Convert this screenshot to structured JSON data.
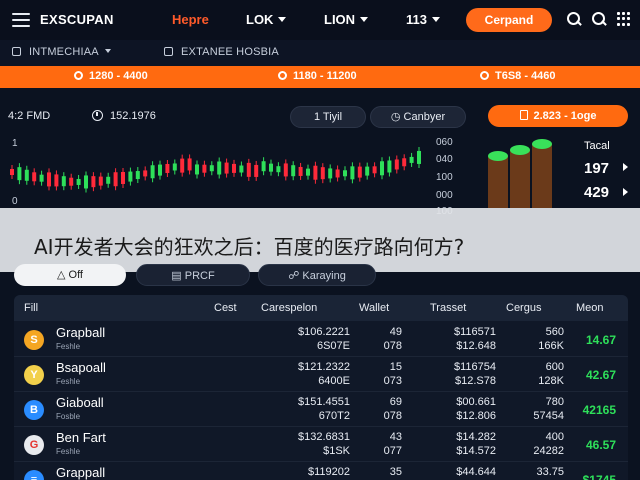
{
  "topnav": {
    "brand": "EXSCUPAN",
    "items": [
      {
        "label": "Hepre",
        "active": true,
        "caret": false
      },
      {
        "label": "LOK",
        "active": false,
        "caret": true
      },
      {
        "label": "LION",
        "active": false,
        "caret": true
      },
      {
        "label": "113",
        "active": false,
        "caret": true
      }
    ],
    "cta_label": "Cerpand",
    "icons": [
      "menu-icon",
      "search-icon",
      "search-icon",
      "grid-icon"
    ]
  },
  "subnav": {
    "left_label": "INTMECHIAA",
    "right_label": "EXTANEE HOSBIA"
  },
  "ticker": {
    "items": [
      "1280 - 4400",
      "1180 - 11200",
      "T6S8 - 4460"
    ],
    "color": "#ff6a10"
  },
  "chart_header": {
    "price_label": "4:2 FMD",
    "time_label": "152.1976",
    "pill_1": "1 Tiyil",
    "pill_2": "Canbyer",
    "pill_orange": "2.823 - 1oge"
  },
  "chart_data": {
    "type": "candlestick",
    "yaxis_ticks": [
      "060",
      "040",
      "100",
      "000",
      "100"
    ],
    "left_ticks": [
      "1",
      "0"
    ],
    "candles_up_color": "#2ee05a",
    "candles_down_color": "#ff2a3a"
  },
  "side_panel": {
    "label": "Tacal",
    "value_1": "197",
    "value_2": "429"
  },
  "banner": {
    "title": "AI开发者大会的狂欢之后：百度的医疗路向何方?"
  },
  "filters": [
    {
      "label": "Off",
      "style": "light"
    },
    {
      "label": "PRCF",
      "style": "dark"
    },
    {
      "label": "Karaying",
      "style": "dark"
    }
  ],
  "table": {
    "headers": [
      "Fill",
      "Cest",
      "Carespelon",
      "Wallet",
      "Trasset",
      "Cergus",
      "Meon"
    ],
    "rows": [
      {
        "name": "Grapball",
        "sub": "Feshle",
        "coin": "S",
        "coin_color": "#f5a623",
        "carespelon": [
          "$106.2221",
          "6S07E"
        ],
        "wallet": [
          "49",
          "078"
        ],
        "trasset": [
          "$116571",
          "$12.648"
        ],
        "cergus": [
          "560",
          "166K"
        ],
        "meon": "14.67"
      },
      {
        "name": "Bsapoall",
        "sub": "Feshle",
        "coin": "Y",
        "coin_color": "#f2d04b",
        "carespelon": [
          "$121.2322",
          "6400E"
        ],
        "wallet": [
          "15",
          "073"
        ],
        "trasset": [
          "$116754",
          "$12.S78"
        ],
        "cergus": [
          "600",
          "128K"
        ],
        "meon": "42.67"
      },
      {
        "name": "Giaboall",
        "sub": "Fosble",
        "coin": "B",
        "coin_color": "#2a8cff",
        "carespelon": [
          "$151.4551",
          "670T2"
        ],
        "wallet": [
          "69",
          "078"
        ],
        "trasset": [
          "$00.661",
          "$12.806"
        ],
        "cergus": [
          "780",
          "57454"
        ],
        "meon": "42165"
      },
      {
        "name": "Ben Fart",
        "sub": "Feshle",
        "coin": "G",
        "coin_color": "#e8eaee",
        "carespelon": [
          "$132.6831",
          "$1SK"
        ],
        "wallet": [
          "43",
          "077"
        ],
        "trasset": [
          "$14.282",
          "$14.572"
        ],
        "cergus": [
          "400",
          "24282"
        ],
        "meon": "46.57"
      },
      {
        "name": "Grappall",
        "sub": "",
        "coin": "≡",
        "coin_color": "#2a8cff",
        "carespelon": [
          "$119202",
          ""
        ],
        "wallet": [
          "35",
          ""
        ],
        "trasset": [
          "$44.644",
          ""
        ],
        "cergus": [
          "33.75",
          ""
        ],
        "meon": "$1745"
      }
    ]
  }
}
